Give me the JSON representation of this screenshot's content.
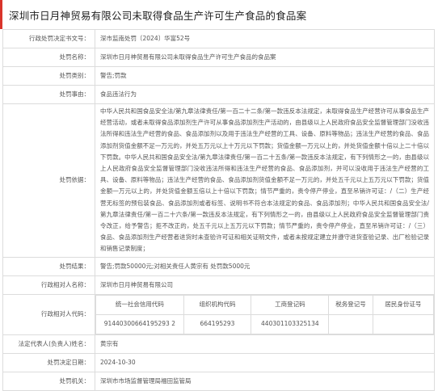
{
  "page_title": "深圳市日月神贸易有限公司未取得食品生产许可生产食品的食品案",
  "labels": {
    "doc_no": "行政处罚决定书文号：",
    "case_name": "处罚名称：",
    "category": "处罚类别：",
    "matter": "处罚事由：",
    "basis": "处罚依据：",
    "result": "处罚结果：",
    "party": "行政相对人名称：",
    "party_code": "行政相对人代码：",
    "legal_rep": "法定代表人(负责人)姓名：",
    "decision_date": "处罚决定日期：",
    "authority": "处罚机关："
  },
  "values": {
    "doc_no": "深市监南处罚〔2024〕华富52号",
    "case_name": "深圳市日月神贸易有限公司未取得食品生产许可生产食品的食品案",
    "category": "警告;罚款",
    "matter": "食品违法行为",
    "basis": "中华人民共和国食品安全法/第九章法律责任/第一百二十二条/第一款违反本法规定，未取得食品生产经营许可从事食品生产经营活动，或者未取得食品添加剂生产许可从事食品添加剂生产活动的，由县级以上人民政府食品安全监督管理部门没收违法所得和违法生产经营的食品、食品添加剂以及用于违法生产经营的工具、设备、原料等物品；违法生产经营的食品、食品添加剂货值金额不足一万元的，并处五万元以上十万元以下罚款；货值金额一万元以上的，并处货值金额十倍以上二十倍以下罚款。中华人民共和国食品安全法/第九章法律责任/第一百二十五条/第一款违反本法规定，有下列情形之一的，由县级以上人民政府食品安全监督管理部门没收违法所得和违法生产经营的食品、食品添加剂，并可以没收用于违法生产经营的工具、设备、原料等物品；违法生产经营的食品、食品添加剂货值金额不足一万元的，并处五千元以上五万元以下罚款；货值金额一万元以上的，并处货值金额五倍以上十倍以下罚款；情节严重的，责令停产停业，直至吊销许可证：/（二）生产经营无标签的预包装食品、食品添加剂或者标签、说明书不符合本法规定的食品、食品添加剂；中华人民共和国食品安全法/第九章法律责任/第一百二十六条/第一款违反本法规定，有下列情形之一的，由县级以上人民政府食品安全监督管理部门责令改正，给予警告；拒不改正的，处五千元以上五万元以下罚款；情节严重的，责令停产停业，直至吊销许可证：/（三）食品、食品添加剂生产经营者进货时未查验许可证和相关证明文件，或者未按规定建立并遵守进货查验记录、出厂检验记录和销售记录制度；",
    "result": "警告;罚款50000元;对相关责任人黄宗有 处罚款5000元",
    "party": "深圳市日月神贸易有限公司",
    "legal_rep": "黄宗有",
    "decision_date": "2024-10-30",
    "authority": "深圳市市场监督管理局福田监管局"
  },
  "codes": {
    "headers": [
      "统一社会信用代码",
      "组织机构代码",
      "工商登记码",
      "税务登记号",
      "居民身份证号"
    ],
    "values": [
      "91440300664195293 2",
      "664195293",
      "440301103325134",
      "",
      ""
    ]
  }
}
